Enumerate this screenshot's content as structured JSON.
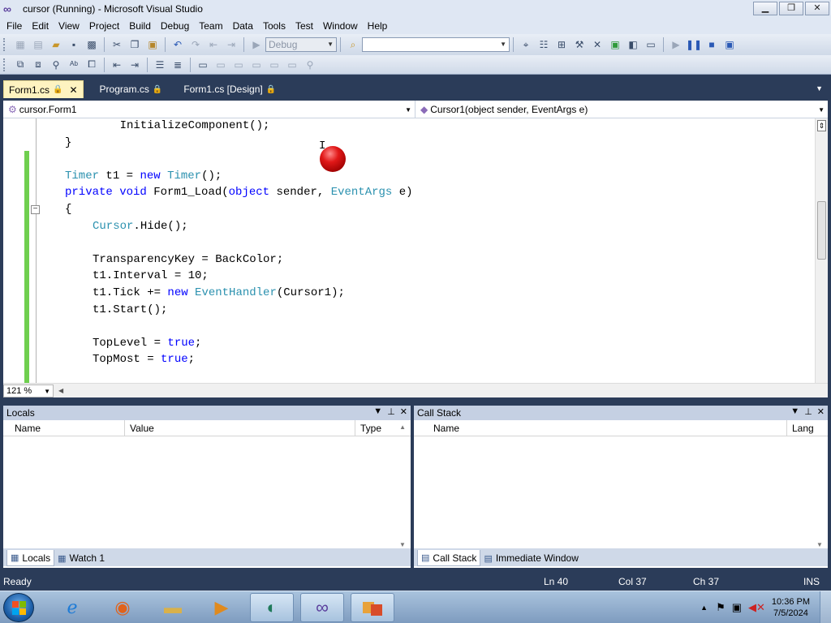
{
  "window": {
    "title": "cursor (Running) - Microsoft Visual Studio",
    "buttons": {
      "minimize": "▁",
      "maximize": "❐",
      "close": "✕"
    }
  },
  "menu": [
    "File",
    "Edit",
    "View",
    "Project",
    "Build",
    "Debug",
    "Team",
    "Data",
    "Tools",
    "Test",
    "Window",
    "Help"
  ],
  "toolbar": {
    "config_combo": "Debug",
    "search_combo": ""
  },
  "doc_tabs": [
    {
      "label": "Form1.cs",
      "active": true
    },
    {
      "label": "Program.cs",
      "active": false
    },
    {
      "label": "Form1.cs [Design]",
      "active": false
    }
  ],
  "nav": {
    "type_combo": "cursor.Form1",
    "member_combo": "Cursor1(object sender, EventArgs e)"
  },
  "editor": {
    "zoom": "121 %"
  },
  "code_lines": [
    "    InitializeComponent();",
    "}",
    "",
    "Timer t1 = new Timer();",
    "private void Form1_Load(object sender, EventArgs e)",
    "{",
    "    Cursor.Hide();",
    "",
    "    TransparencyKey = BackColor;",
    "    t1.Interval = 10;",
    "    t1.Tick += new EventHandler(Cursor1);",
    "    t1.Start();",
    "",
    "    TopLevel = true;",
    "    TopMost = true;"
  ],
  "locals_panel": {
    "title": "Locals",
    "columns": [
      "Name",
      "Value",
      "Type"
    ],
    "tabs": [
      "Locals",
      "Watch 1"
    ]
  },
  "callstack_panel": {
    "title": "Call Stack",
    "columns": [
      "Name",
      "Lang"
    ],
    "tabs": [
      "Call Stack",
      "Immediate Window"
    ]
  },
  "status": {
    "text": "Ready",
    "ln": "Ln 40",
    "col": "Col 37",
    "ch": "Ch 37",
    "mode": "INS"
  },
  "taskbar": {
    "time": "10:36 PM",
    "date": "7/5/2024"
  }
}
